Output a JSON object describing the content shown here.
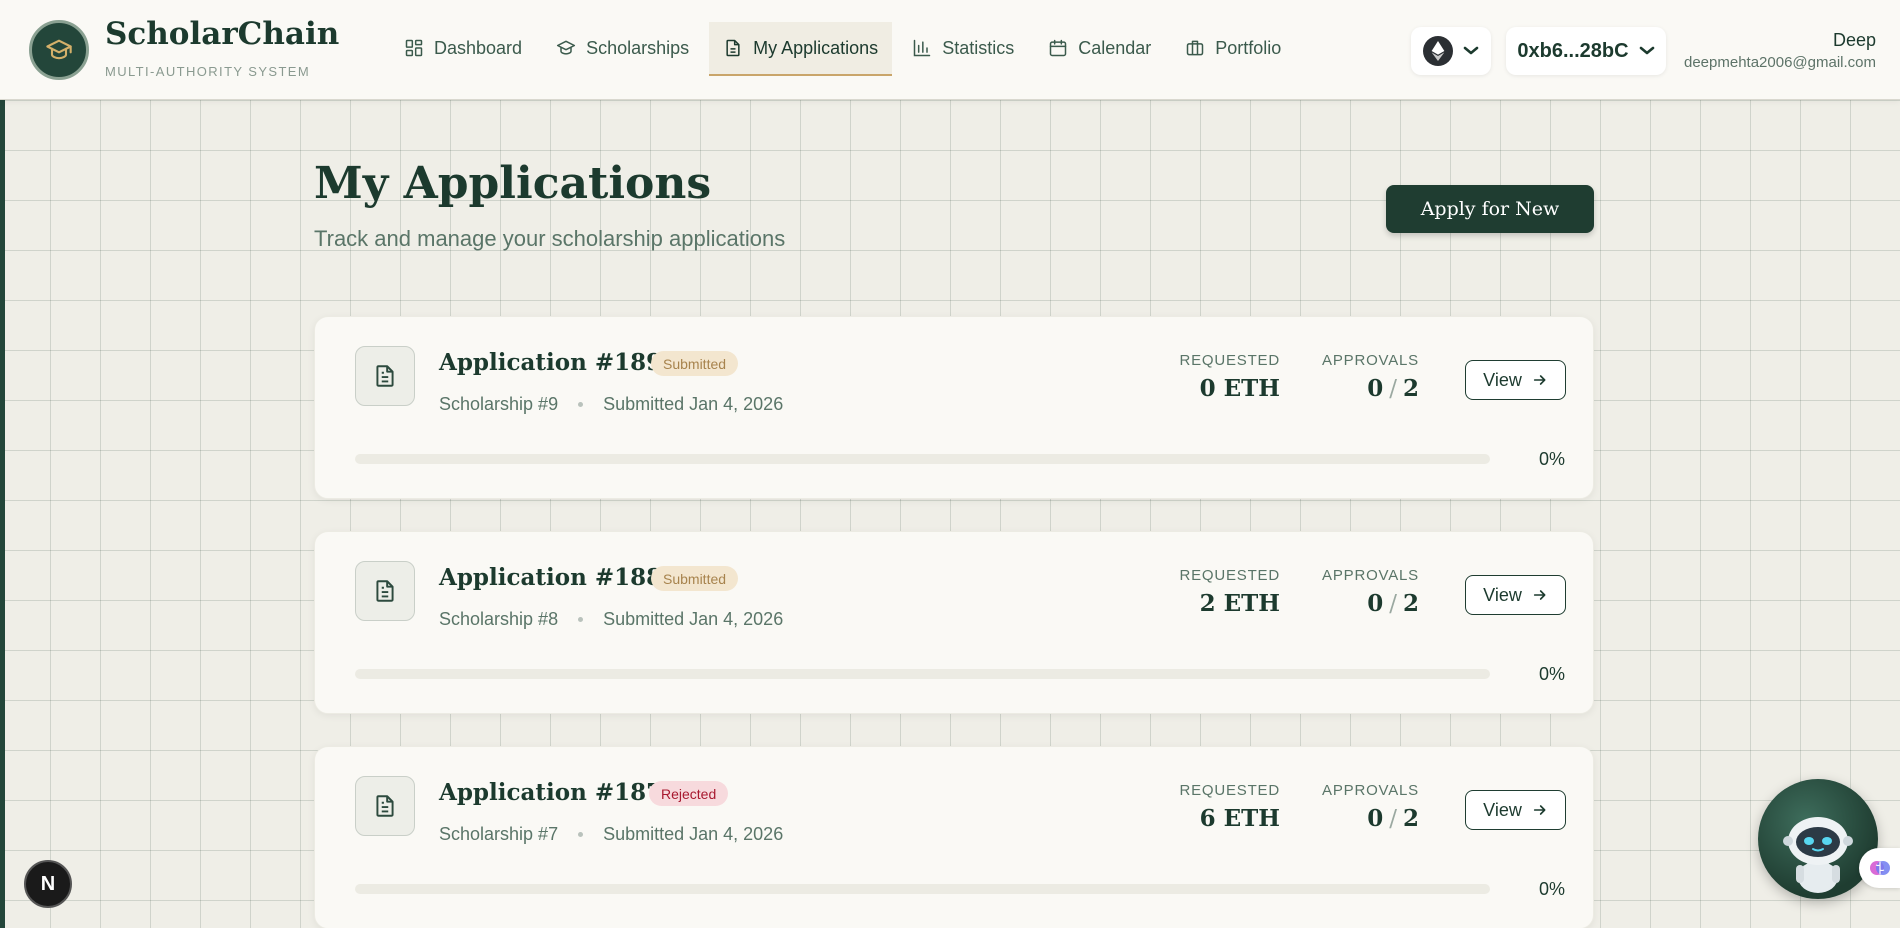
{
  "brand": {
    "name": "ScholarChain",
    "subtitle": "MULTI-AUTHORITY SYSTEM"
  },
  "nav": [
    {
      "label": "Dashboard",
      "icon": "grid-icon"
    },
    {
      "label": "Scholarships",
      "icon": "graduation-cap-icon"
    },
    {
      "label": "My Applications",
      "icon": "document-icon",
      "active": true
    },
    {
      "label": "Statistics",
      "icon": "bar-chart-icon"
    },
    {
      "label": "Calendar",
      "icon": "calendar-icon"
    },
    {
      "label": "Portfolio",
      "icon": "briefcase-icon"
    }
  ],
  "network": {
    "icon": "ethereum-icon"
  },
  "wallet": {
    "address": "0xb6...28bC"
  },
  "user": {
    "name": "Deep",
    "email": "deepmehta2006@gmail.com"
  },
  "page": {
    "title": "My Applications",
    "subtitle": "Track and manage your scholarship applications",
    "apply_label": "Apply for New"
  },
  "labels": {
    "requested": "REQUESTED",
    "approvals": "APPROVALS",
    "view": "View"
  },
  "applications": [
    {
      "title": "Application #189",
      "status": "Submitted",
      "scholarship": "Scholarship #9",
      "submitted": "Submitted Jan 4, 2026",
      "requested": "0 ETH",
      "approved": "0",
      "required": "2",
      "progress_text": "0%",
      "progress": 0
    },
    {
      "title": "Application #188",
      "status": "Submitted",
      "scholarship": "Scholarship #8",
      "submitted": "Submitted Jan 4, 2026",
      "requested": "2 ETH",
      "approved": "0",
      "required": "2",
      "progress_text": "0%",
      "progress": 0
    },
    {
      "title": "Application #187",
      "status": "Rejected",
      "scholarship": "Scholarship #7",
      "submitted": "Submitted Jan 4, 2026",
      "requested": "6 ETH",
      "approved": "0",
      "required": "2",
      "progress_text": "0%",
      "progress": 0
    }
  ],
  "colors": {
    "primary": "#1f3d31",
    "accent": "#c9a56a",
    "submitted_bg": "#f3e6cf",
    "rejected_bg": "#f7dadd"
  }
}
